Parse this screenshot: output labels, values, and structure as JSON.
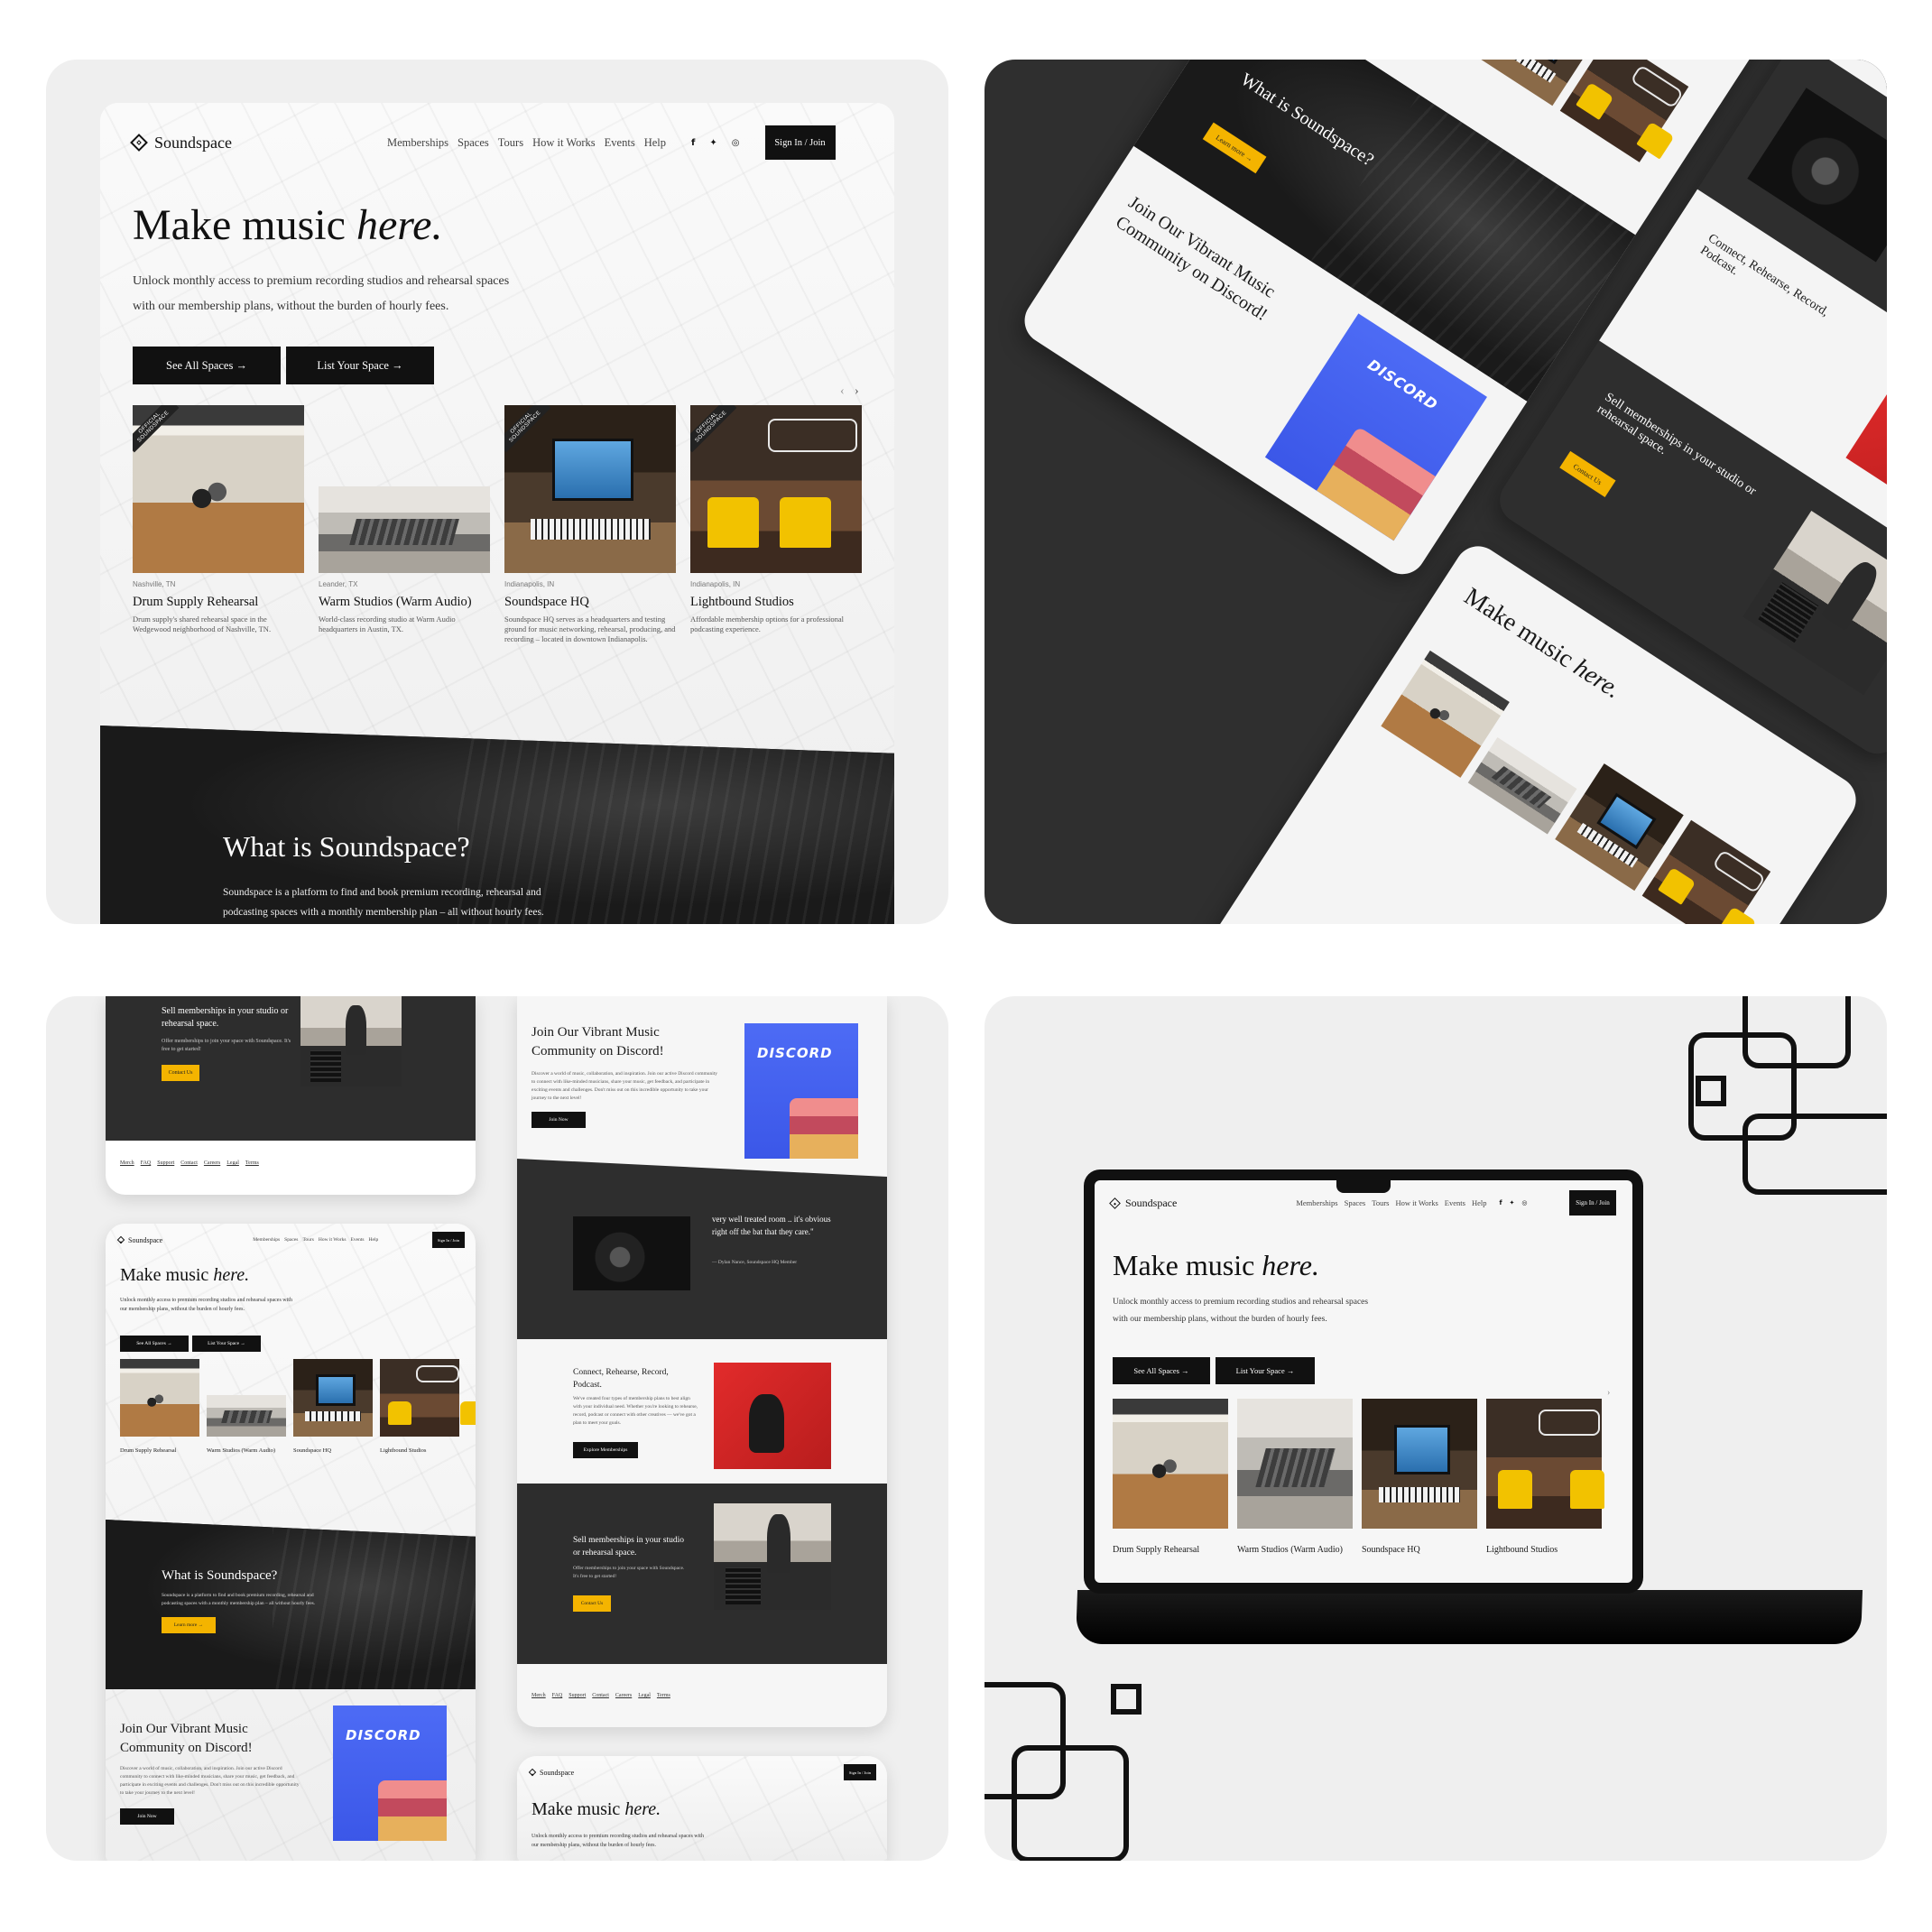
{
  "site": {
    "brand": "Soundspace",
    "nav": [
      "Memberships",
      "Spaces",
      "Tours",
      "How it Works",
      "Events",
      "Help"
    ],
    "social": [
      "f",
      "t",
      "ig"
    ],
    "signin": "Sign In / Join",
    "hero_title_a": "Make music ",
    "hero_title_b": "here.",
    "hero_sub": "Unlock monthly access to premium recording studios and rehearsal spaces with our membership plans, without the burden of hourly fees.",
    "btn_all": "See All Spaces →",
    "btn_list": "List Your Space →",
    "carousel_prev": "‹",
    "carousel_next": "›",
    "badge": "OFFICIAL SOUNDSPACE",
    "cards": [
      {
        "loc": "Nashville, TN",
        "title": "Drum Supply Rehearsal",
        "desc": "Drum supply's shared rehearsal space in the Wedgewood neighborhood of Nashville, TN."
      },
      {
        "loc": "Leander, TX",
        "title": "Warm Studios (Warm Audio)",
        "desc": "World-class recording studio at Warm Audio headquarters in Austin, TX."
      },
      {
        "loc": "Indianapolis, IN",
        "title": "Soundspace HQ",
        "desc": "Soundspace HQ serves as a headquarters and testing ground for music networking, rehearsal, producing, and recording – located in downtown Indianapolis."
      },
      {
        "loc": "Indianapolis, IN",
        "title": "Lightbound Studios",
        "desc": "Affordable membership options for a professional podcasting experience."
      }
    ],
    "what_title": "What is Soundspace?",
    "what_text": "Soundspace is a platform to find and book premium recording, rehearsal and podcasting spaces with a monthly membership plan – all without hourly fees.",
    "learn_more": "Learn more →",
    "discord_title": "Join Our Vibrant Music Community on Discord!",
    "discord_text": "Discover a world of music, collaboration, and inspiration. Join our active Discord community to connect with like-minded musicians, share your music, get feedback, and participate in exciting events and challenges. Don't miss out on this incredible opportunity to take your journey to the next level!",
    "discord_label": "DISCORD",
    "join_now": "Join Now",
    "quote_text": "very well treated room .. it's obvious right off the bat that they care.\"",
    "quote_author": "— Dylan Nance, Soundspace HQ Member",
    "connect_title": "Connect, Rehearse, Record, Podcast.",
    "connect_text": "We've created four types of membership plans to best align with your individual need. Whether you're looking to rehearse, record, podcast or connect with other creatives — we've got a plan to meet your goals.",
    "explore": "Explore Memberships",
    "sell_title": "Sell memberships in your studio or rehearsal space.",
    "sell_text": "Offer memberships to join your space with Soundspace. It's free to get started!",
    "contact": "Contact Us",
    "footer": [
      "Merch",
      "FAQ",
      "Support",
      "Contact",
      "Careers",
      "Legal",
      "Terms"
    ]
  },
  "colors": {
    "tile_bg": "#efefef",
    "dark": "#111111",
    "accent_yellow": "#f4b400",
    "discord_blue": "#4d6bf5",
    "red": "#e22b2b"
  }
}
